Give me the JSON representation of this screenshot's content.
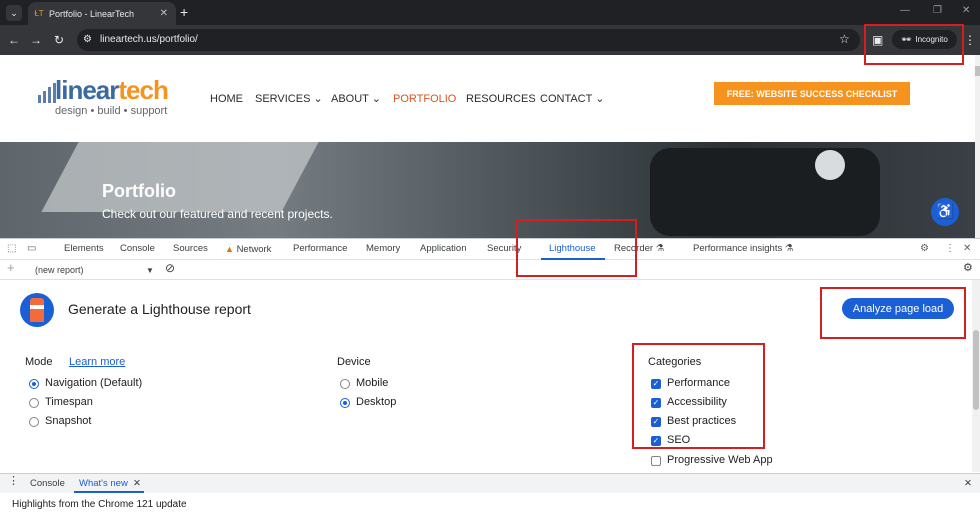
{
  "browser": {
    "tab_title": "Portfolio - LinearTech",
    "tab_close": "✕",
    "new_tab": "+",
    "url": "lineartech.us/portfolio/",
    "incognito_label": "Incognito"
  },
  "site": {
    "logo_linear": "linear",
    "logo_tech": "tech",
    "logo_tagline": "design • build • support",
    "nav": [
      "HOME",
      "SERVICES ⌄",
      "ABOUT ⌄",
      "PORTFOLIO",
      "RESOURCES",
      "CONTACT ⌄"
    ],
    "cta": "FREE: WEBSITE SUCCESS CHECKLIST",
    "hero_title": "Portfolio",
    "hero_subtitle": "Check out our featured and recent projects."
  },
  "devtools": {
    "tabs": [
      "Elements",
      "Console",
      "Sources",
      "Network",
      "Performance",
      "Memory",
      "Application",
      "Security",
      "Lighthouse",
      "Recorder",
      "Performance insights"
    ],
    "active_tab": "Lighthouse",
    "report_select": "(new report)",
    "lighthouse": {
      "title": "Generate a Lighthouse report",
      "analyze_button": "Analyze page load",
      "mode_heading": "Mode",
      "learn_more": "Learn more",
      "modes": [
        {
          "label": "Navigation (Default)",
          "selected": true
        },
        {
          "label": "Timespan",
          "selected": false
        },
        {
          "label": "Snapshot",
          "selected": false
        }
      ],
      "device_heading": "Device",
      "devices": [
        {
          "label": "Mobile",
          "selected": false
        },
        {
          "label": "Desktop",
          "selected": true
        }
      ],
      "categories_heading": "Categories",
      "categories": [
        {
          "label": "Performance",
          "checked": true
        },
        {
          "label": "Accessibility",
          "checked": true
        },
        {
          "label": "Best practices",
          "checked": true
        },
        {
          "label": "SEO",
          "checked": true
        },
        {
          "label": "Progressive Web App",
          "checked": false
        }
      ]
    },
    "drawer": {
      "tabs": [
        "Console",
        "What's new"
      ],
      "active_tab": "What's new",
      "body": "Highlights from the Chrome 121 update"
    }
  },
  "colors": {
    "accent": "#1a5fd6",
    "brand_orange": "#f6931e",
    "highlight_red": "#d31f1f"
  }
}
